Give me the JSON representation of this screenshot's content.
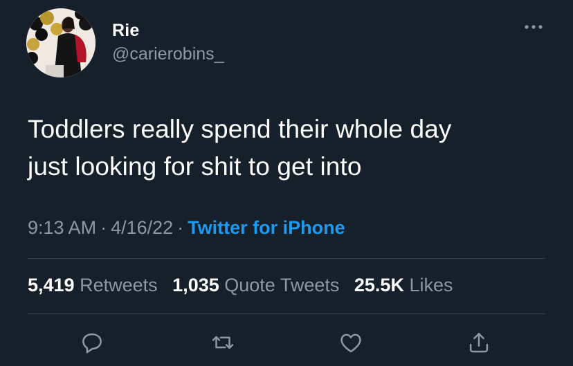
{
  "user": {
    "name": "Rie",
    "handle": "@carierobins_",
    "avatar_icon": "profile-photo"
  },
  "tweet": {
    "text_line1": "Toddlers really spend their whole day",
    "text_line2": "just looking for shit to get into"
  },
  "meta": {
    "time": "9:13 AM",
    "separator": "·",
    "date": "4/16/22",
    "source": "Twitter for iPhone"
  },
  "stats": {
    "retweets_count": "5,419",
    "retweets_label": "Retweets",
    "quotes_count": "1,035",
    "quotes_label": "Quote Tweets",
    "likes_count": "25.5K",
    "likes_label": "Likes"
  },
  "actions": [
    "reply-icon",
    "retweet-icon",
    "like-icon",
    "share-icon"
  ],
  "colors": {
    "background": "#15202b",
    "text": "#ffffff",
    "secondary": "#8b98a5",
    "accent": "#1d9bf0",
    "divider": "#38444d"
  }
}
